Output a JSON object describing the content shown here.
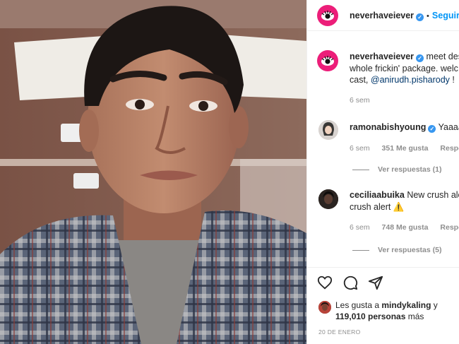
{
  "post": {
    "username": "neverhaveiever",
    "follow_label": "Seguir",
    "verified_glyph": "✓",
    "separator": "•",
    "caption_user": "neverhaveiever",
    "caption_line1": "meet des",
    "caption_line2": "whole frickin' package. welc",
    "caption_line3_prefix": "cast, ",
    "caption_mention": "@anirudh.pisharody",
    "caption_line3_suffix": " !",
    "caption_time": "6 sem"
  },
  "comments": [
    {
      "username": "ramonabishyoung",
      "verified": true,
      "text": "Yaaaa",
      "time": "6 sem",
      "likes": "351 Me gusta",
      "reply": "Respond",
      "view_replies": "Ver respuestas (1)"
    },
    {
      "username": "ceciliaabuika",
      "verified": false,
      "text": "New crush ale",
      "text_line2": "crush alert",
      "emoji": "⚠️",
      "time": "6 sem",
      "likes": "748 Me gusta",
      "reply": "Respond",
      "view_replies": "Ver respuestas (5)"
    }
  ],
  "actions": {
    "like_icon": "heart-icon",
    "comment_icon": "comment-icon",
    "share_icon": "paper-plane-icon"
  },
  "likes": {
    "prefix": "Les gusta a ",
    "user": "mindykaling",
    "suffix": " y",
    "count": "119,010 personas",
    "count_suffix": " más"
  },
  "date": "20 DE ENERO",
  "colors": {
    "brand_pink": "#ec1e79",
    "follow_blue": "#0095f6",
    "verified_blue": "#3897f0",
    "mention_blue": "#00376b",
    "muted": "#8e8e8e"
  }
}
